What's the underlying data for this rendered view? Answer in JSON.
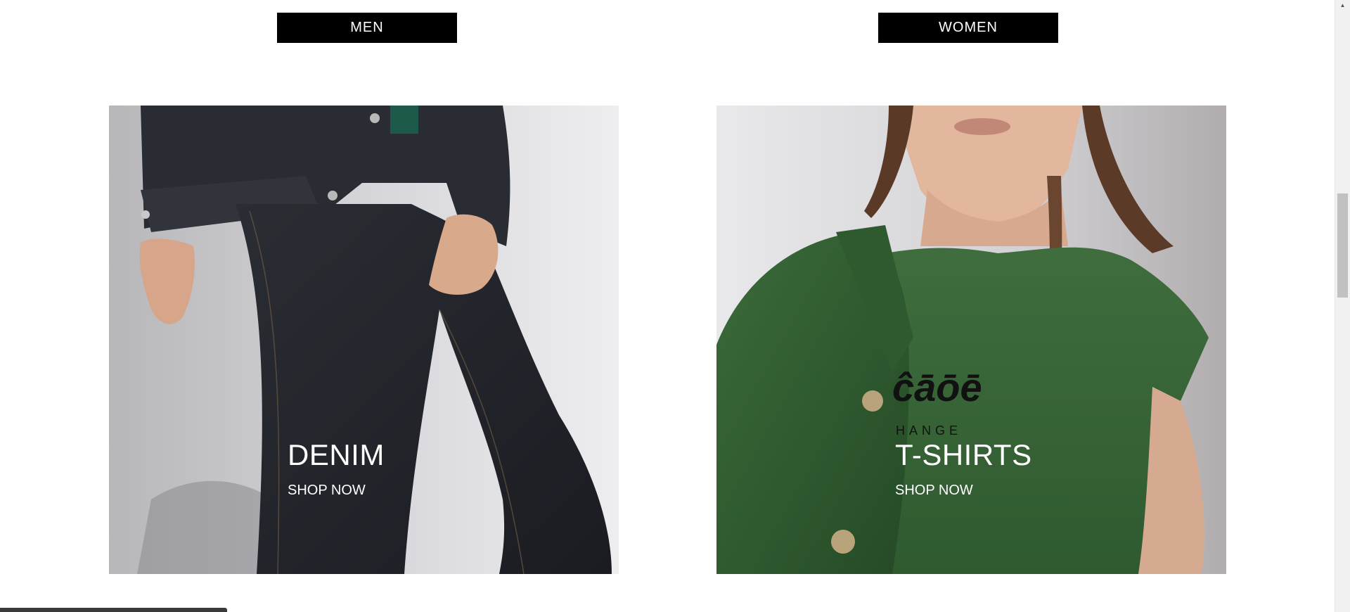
{
  "categories": {
    "men_label": "MEN",
    "women_label": "WOMEN"
  },
  "tiles": [
    {
      "title": "DENIM",
      "cta": "SHOP NOW"
    },
    {
      "title": "T-SHIRTS",
      "cta": "SHOP NOW"
    }
  ],
  "colors": {
    "button_bg": "#000000",
    "button_text": "#ffffff",
    "caption_text": "#ffffff",
    "background": "#ffffff"
  },
  "icons": {
    "scroll_up": "scroll-up-arrow-icon"
  }
}
